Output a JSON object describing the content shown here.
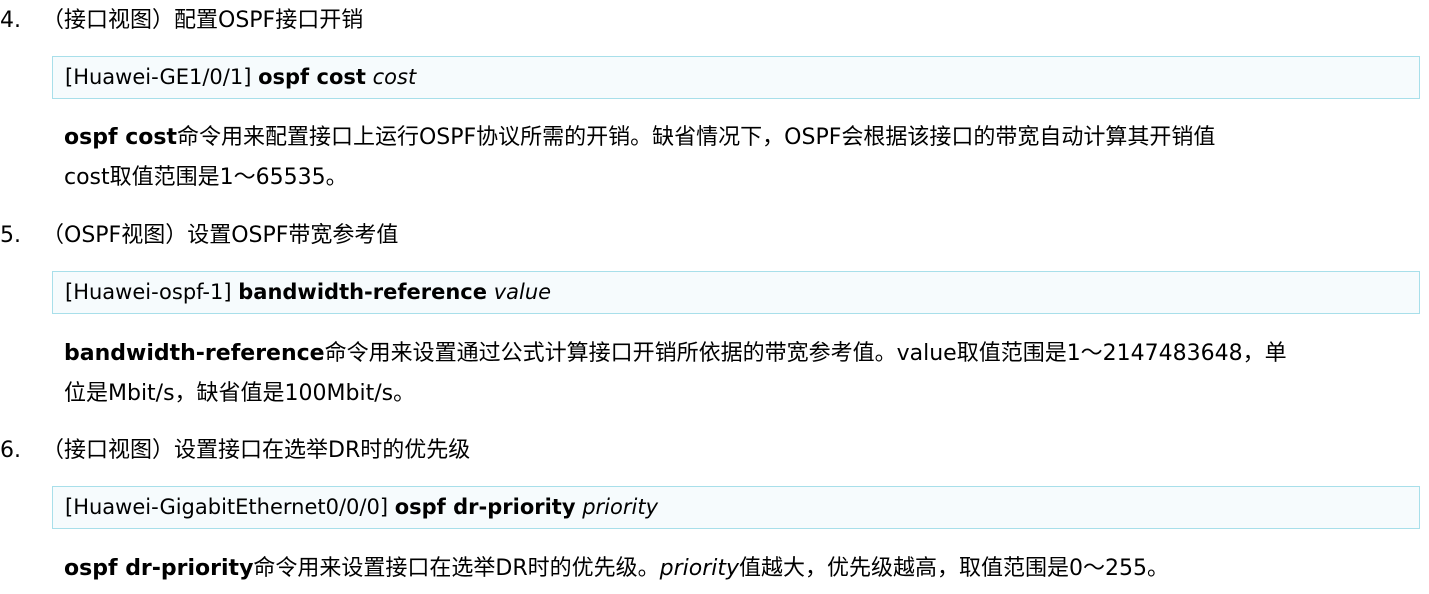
{
  "steps": [
    {
      "number": "4.",
      "title": "（接口视图）配置OSPF接口开销",
      "command": {
        "prompt": "[Huawei-GE1/0/1]",
        "keyword": "ospf cost",
        "param": "cost"
      },
      "desc": {
        "lead": "ospf cost",
        "line1": "命令用来配置接口上运行OSPF协议所需的开销。缺省情况下，OSPF会根据该接口的带宽自动计算其开销值",
        "line2": "cost取值范围是1～65535。"
      }
    },
    {
      "number": "5.",
      "title": "（OSPF视图）设置OSPF带宽参考值",
      "command": {
        "prompt": "[Huawei-ospf-1]",
        "keyword": "bandwidth-reference",
        "param": "value"
      },
      "desc": {
        "lead": "bandwidth-reference",
        "line1": "命令用来设置通过公式计算接口开销所依据的带宽参考值。value取值范围是1～2147483648，单",
        "line2": "位是Mbit/s，缺省值是100Mbit/s。"
      }
    },
    {
      "number": "6.",
      "title": "（接口视图）设置接口在选举DR时的优先级",
      "command": {
        "prompt": "[Huawei-GigabitEthernet0/0/0]",
        "keyword": "ospf dr-priority",
        "param": "priority"
      },
      "desc": {
        "lead": "ospf dr-priority",
        "text1": "命令用来设置接口在选举DR时的优先级。",
        "param": "priority",
        "text2": "值越大，优先级越高，取值范围是0～255。"
      }
    }
  ]
}
